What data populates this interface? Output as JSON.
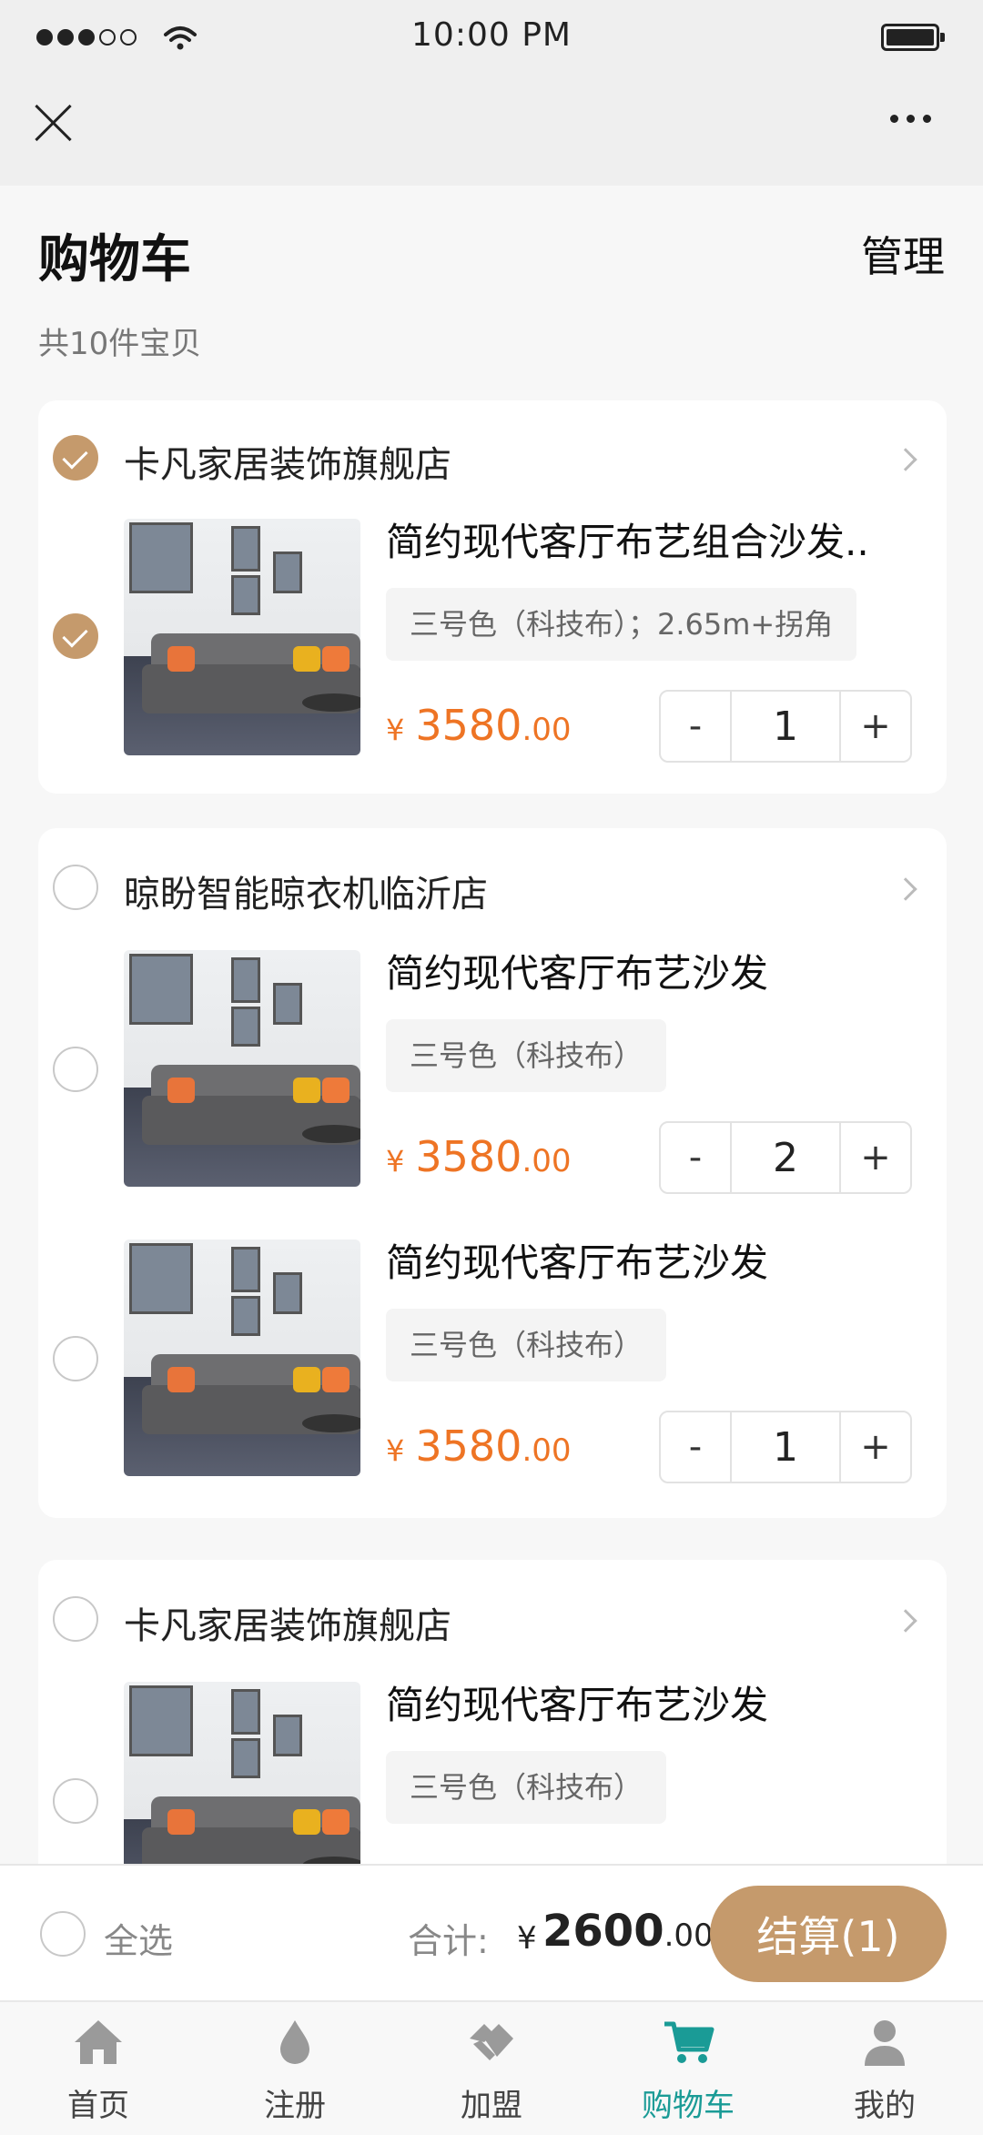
{
  "status": {
    "time": "10:00 PM"
  },
  "header": {
    "title": "购物车",
    "manage": "管理",
    "count": "共10件宝贝"
  },
  "stores": [
    {
      "name": "卡凡家居装饰旗舰店",
      "checked": true,
      "items": [
        {
          "title": "简约现代客厅布艺组合沙发..",
          "spec": "三号色（科技布）；2.65m+拐角",
          "price_yen": "¥",
          "price_int": "3580",
          "price_dec": ".00",
          "qty": "1",
          "checked": true
        }
      ]
    },
    {
      "name": "晾盼智能晾衣机临沂店",
      "checked": false,
      "items": [
        {
          "title": "简约现代客厅布艺沙发",
          "spec": "三号色（科技布）",
          "price_yen": "¥",
          "price_int": "3580",
          "price_dec": ".00",
          "qty": "2",
          "checked": false
        },
        {
          "title": "简约现代客厅布艺沙发",
          "spec": "三号色（科技布）",
          "price_yen": "¥",
          "price_int": "3580",
          "price_dec": ".00",
          "qty": "1",
          "checked": false
        }
      ]
    },
    {
      "name": "卡凡家居装饰旗舰店",
      "checked": false,
      "items": [
        {
          "title": "简约现代客厅布艺沙发",
          "spec": "三号色（科技布）",
          "checked": false
        }
      ]
    }
  ],
  "stepper": {
    "minus": "-",
    "plus": "+"
  },
  "checkout": {
    "select_all": "全选",
    "total_label": "合计:",
    "total_yen": "¥",
    "total_int": "2600",
    "total_dec": ".00",
    "pay_label": "结算(1)"
  },
  "tabs": [
    {
      "label": "首页",
      "icon": "home-icon"
    },
    {
      "label": "注册",
      "icon": "drop-icon"
    },
    {
      "label": "加盟",
      "icon": "handshake-icon"
    },
    {
      "label": "购物车",
      "icon": "cart-icon",
      "active": true
    },
    {
      "label": "我的",
      "icon": "user-icon"
    }
  ],
  "colors": {
    "accent": "#c59a6c",
    "price": "#ee7424",
    "tab_active": "#1a9b96"
  }
}
